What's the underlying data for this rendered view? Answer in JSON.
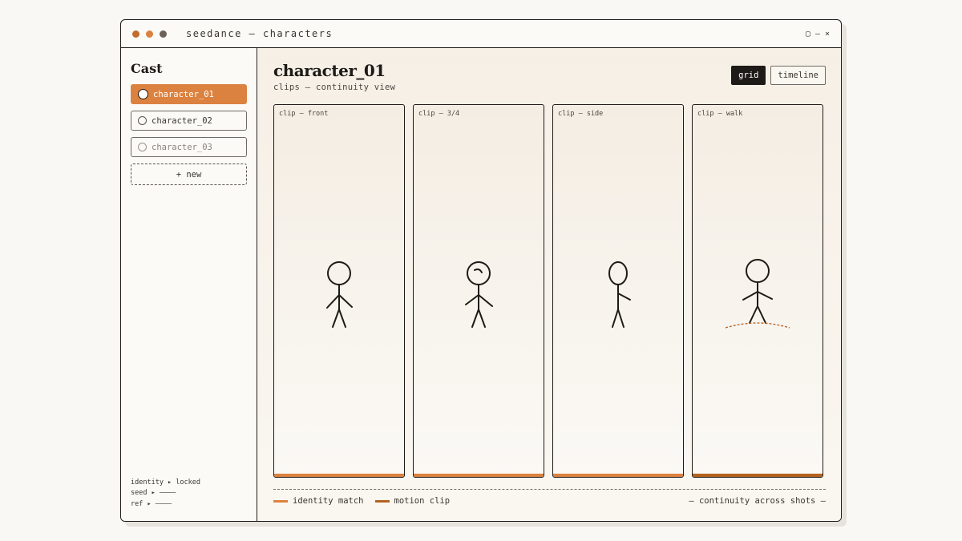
{
  "window": {
    "title": "seedance — characters",
    "dots": [
      "#c26b2c",
      "#dc8240",
      "#6b6159"
    ],
    "controls": {
      "maximize": "▢",
      "minimize": "—",
      "close": "×"
    }
  },
  "sidebar": {
    "title": "Cast",
    "items": [
      {
        "label": "character_01",
        "state": "active"
      },
      {
        "label": "character_02",
        "state": "normal"
      },
      {
        "label": "character_03",
        "state": "dim"
      }
    ],
    "new_label": "+ new",
    "meta": [
      "identity ▸ locked",
      "seed ▸ ————",
      "ref ▸ ————"
    ]
  },
  "main": {
    "title": "character_01",
    "subtitle": "clips — continuity view",
    "views": [
      {
        "label": "grid",
        "active": true
      },
      {
        "label": "timeline",
        "active": false
      }
    ],
    "clips": [
      {
        "label": "clip — front",
        "pose": "front-icon",
        "bar": "#dc8240"
      },
      {
        "label": "clip — 3/4",
        "pose": "three-quarter-icon",
        "bar": "#dc8240"
      },
      {
        "label": "clip — side",
        "pose": "side-icon",
        "bar": "#dc8240"
      },
      {
        "label": "clip — walk",
        "pose": "walk-icon",
        "bar": "#b5621f"
      }
    ],
    "legend": [
      {
        "label": "identity match",
        "color": "#dc8240"
      },
      {
        "label": "motion clip",
        "color": "#b5621f"
      }
    ],
    "footnote": "— continuity across shots —"
  },
  "colors": {
    "accent": "#dc8240",
    "accent_dark": "#b5621f",
    "ink": "#1d1a17"
  }
}
